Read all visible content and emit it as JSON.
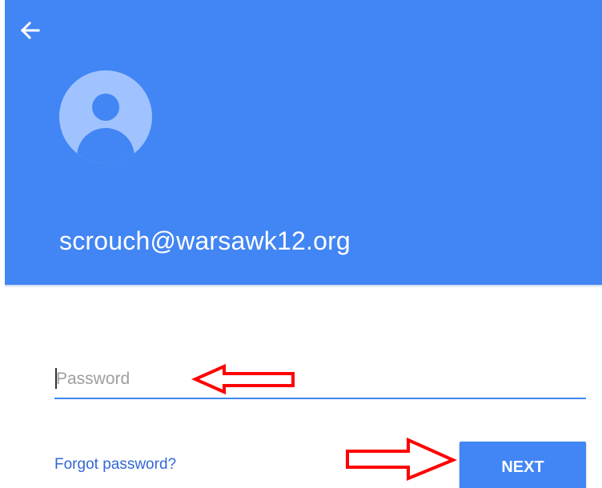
{
  "header": {
    "back_icon": "arrow-left-icon",
    "avatar_icon": "account-avatar-icon",
    "email": "scrouch@warsawk12.org"
  },
  "form": {
    "password_placeholder": "Password",
    "password_value": "",
    "forgot_label": "Forgot password?",
    "next_label": "NEXT"
  },
  "annotations": [
    {
      "kind": "arrow-left",
      "color": "#ff0000",
      "target": "password-input"
    },
    {
      "kind": "arrow-right",
      "color": "#ff0000",
      "target": "next-button"
    }
  ],
  "colors": {
    "brand": "#4285f4",
    "avatar_bg": "#a0c3ff",
    "link": "#3367d6",
    "annotation": "#ff0000"
  }
}
